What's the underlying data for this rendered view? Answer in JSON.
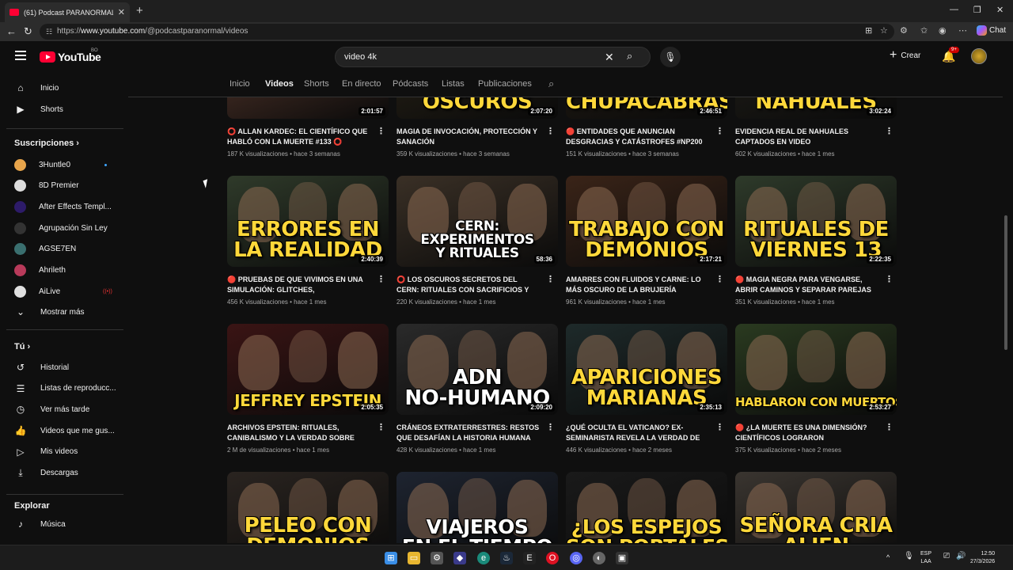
{
  "browser": {
    "tab_title": "(61) Podcast PARANORMAL - YouT",
    "url_prefix": "https://",
    "url_host": "www.youtube.com",
    "url_path": "/@podcastparanormal/videos",
    "chat_label": "Chat"
  },
  "header": {
    "logo_text": "YouTube",
    "country_code": "BO",
    "search_value": "video 4k",
    "create_label": "Crear",
    "notifications": "9+"
  },
  "sidebar": {
    "main": [
      {
        "label": "Inicio",
        "icon": "home-icon"
      },
      {
        "label": "Shorts",
        "icon": "shorts-icon"
      }
    ],
    "subs_heading": "Suscripciones",
    "subscriptions": [
      {
        "label": "3Huntle0",
        "color": "#e8a54b"
      },
      {
        "label": "8D Premier",
        "color": "#dddddd"
      },
      {
        "label": "After Effects Templ...",
        "color": "#2d1b69"
      },
      {
        "label": "Agrupación Sin Ley",
        "color": "#333333"
      },
      {
        "label": "AGSE7EN",
        "color": "#3a6f6f"
      },
      {
        "label": "Ahrileth",
        "color": "#b83a5a"
      },
      {
        "label": "AiLive",
        "color": "#e0e0e0"
      }
    ],
    "show_more": "Mostrar más",
    "you_heading": "Tú",
    "you_items": [
      {
        "label": "Historial",
        "icon": "history-icon"
      },
      {
        "label": "Listas de reproducc...",
        "icon": "playlist-icon"
      },
      {
        "label": "Ver más tarde",
        "icon": "clock-icon"
      },
      {
        "label": "Videos que me gus...",
        "icon": "like-icon"
      },
      {
        "label": "Mis videos",
        "icon": "my-videos-icon"
      },
      {
        "label": "Descargas",
        "icon": "download-icon"
      }
    ],
    "explore_heading": "Explorar",
    "explore_items": [
      {
        "label": "Música",
        "icon": "music-icon"
      }
    ]
  },
  "channel_tabs": [
    "Inicio",
    "Videos",
    "Shorts",
    "En directo",
    "Pódcasts",
    "Listas",
    "Publicaciones"
  ],
  "active_tab": "Videos",
  "videos": [
    {
      "title": "⭕ ALLAN KARDEC: EL CIENTÍFICO QUE HABLÓ CON LA MUERTE #133 ⭕",
      "meta": "187 K visualizaciones • hace 3 semanas",
      "duration": "2:01:57",
      "thumb_text": "",
      "bg": "#5a3a2e"
    },
    {
      "title": "MAGIA DE INVOCACIÓN, PROTECCIÓN Y SANACIÓN",
      "meta": "359 K visualizaciones • hace 3 semanas",
      "duration": "2:07:20",
      "thumb_text": "OSCUROS",
      "bg": "#2a2418"
    },
    {
      "title": "🔴 ENTIDADES QUE ANUNCIAN DESGRACIAS Y CATÁSTROFES #NP200 🔴",
      "meta": "151 K visualizaciones • hace 3 semanas",
      "duration": "2:46:51",
      "thumb_text": "CHUPACABRAS",
      "bg": "#241d14"
    },
    {
      "title": "EVIDENCIA REAL DE NAHUALES CAPTADOS EN VIDEO",
      "meta": "602 K visualizaciones • hace 1 mes",
      "duration": "3:02:24",
      "thumb_text": "NAHUALES",
      "bg": "#22201a"
    },
    {
      "title": "🔴 PRUEBAS DE QUE VIVIMOS EN UNA SIMULACIÓN: GLITCHES, EXPERIMENTOS ...",
      "meta": "456 K visualizaciones • hace 1 mes",
      "duration": "2:40:39",
      "thumb_text": "ERRORES EN|LA REALIDAD",
      "bg": "#2f3a2a"
    },
    {
      "title": "⭕ LOS OSCUROS SECRETOS DEL CERN: RITUALES CON SACRIFICIOS Y CIENCIA...",
      "meta": "220 K visualizaciones • hace 1 mes",
      "duration": "58:36",
      "thumb_text": "CERN:|EXPERIMENTOS|Y RITUALES",
      "bg": "#3a3026"
    },
    {
      "title": "AMARRES CON FLUIDOS Y CARNE: LO MÁS OSCURO DE LA BRUJERÍA",
      "meta": "961 K visualizaciones • hace 1 mes",
      "duration": "2:17:21",
      "thumb_text": "TRABAJO CON|DEMONIOS",
      "bg": "#3a2418"
    },
    {
      "title": "🔴 MAGIA NEGRA PARA VENGARSE, ABRIR CAMINOS Y SEPARAR PAREJAS #NP198 🔴",
      "meta": "351 K visualizaciones • hace 1 mes",
      "duration": "2:22:35",
      "thumb_text": "RITUALES DE|VIERNES 13",
      "bg": "#2e3a2a"
    },
    {
      "title": "ARCHIVOS EPSTEIN: RITUALES, CANIBALISMO Y LA VERDAD SOBRE SU...",
      "meta": "2 M de visualizaciones • hace 1 mes",
      "duration": "2:05:35",
      "thumb_text": "JEFFREY EPSTEIN",
      "bg": "#3a1414"
    },
    {
      "title": "CRÁNEOS EXTRATERRESTRES: RESTOS QUE DESAFÍAN LA HISTORIA HUMANA",
      "meta": "428 K visualizaciones • hace 1 mes",
      "duration": "2:09:20",
      "thumb_text": "ADN|NO-HUMANO",
      "bg": "#2a2a2a"
    },
    {
      "title": "¿QUÉ OCULTA EL VATICANO? EX-SEMINARISTA REVELA LA VERDAD DE LAS...",
      "meta": "446 K visualizaciones • hace 2 meses",
      "duration": "2:35:13",
      "thumb_text": "APARICIONES|MARIANAS",
      "bg": "#1e2a2a"
    },
    {
      "title": "🔴 ¿LA MUERTE ES UNA DIMENSIÓN? CIENTÍFICOS LOGRARON COMUNICARSE...",
      "meta": "375 K visualizaciones • hace 2 meses",
      "duration": "2:53:27",
      "thumb_text": "HABLARON CON MUERTOS",
      "bg": "#2a3a20"
    },
    {
      "title": "",
      "meta": "",
      "duration": "",
      "thumb_text": "PELEO CON|DEMONIOS",
      "bg": "#2a2420"
    },
    {
      "title": "",
      "meta": "",
      "duration": "",
      "thumb_text": "VIAJEROS|EN EL TIEMPO",
      "bg": "#1e2430"
    },
    {
      "title": "",
      "meta": "",
      "duration": "",
      "thumb_text": "¿LOS ESPEJOS|SON PORTALES",
      "bg": "#1a1a1a"
    },
    {
      "title": "",
      "meta": "",
      "duration": "",
      "thumb_text": "SEÑORA CRIA|ALIEN",
      "bg": "#3a3530"
    }
  ],
  "taskbar": {
    "lang_line1": "ESP",
    "lang_line2": "LAA",
    "time": "12:50",
    "date": "27/3/2026"
  }
}
